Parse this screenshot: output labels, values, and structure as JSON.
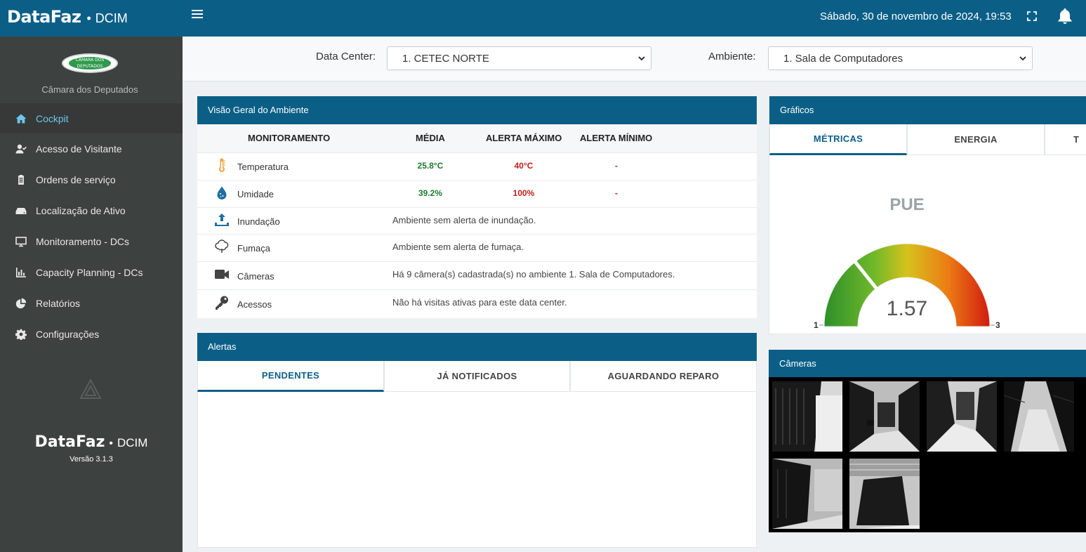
{
  "header": {
    "brand": "DataFaz",
    "brand_sep": "•",
    "brand_suffix": "DCIM",
    "datetime": "Sábado, 30 de novembro de 2024, 19:53",
    "menu_icon": "hamburger-icon",
    "fullscreen_icon": "fullscreen-icon",
    "notify_icon": "bell-icon",
    "color": "#0b5f87"
  },
  "sidebar": {
    "org_logo_text": "CÂMARA DOS DEPUTADOS",
    "org_name": "Câmara dos Deputados",
    "items": [
      {
        "label": "Cockpit",
        "icon": "home-icon",
        "active": true
      },
      {
        "label": "Acesso de Visitante",
        "icon": "user-check-icon"
      },
      {
        "label": "Ordens de serviço",
        "icon": "clipboard-icon"
      },
      {
        "label": "Localização de Ativo",
        "icon": "hard-drive-icon"
      },
      {
        "label": "Monitoramento - DCs",
        "icon": "monitor-icon"
      },
      {
        "label": "Capacity Planning - DCs",
        "icon": "bar-chart-icon"
      },
      {
        "label": "Relatórios",
        "icon": "pie-chart-icon"
      },
      {
        "label": "Configurações",
        "icon": "gear-icon"
      }
    ],
    "footer_brand": "DataFaz",
    "footer_sep": "•",
    "footer_suffix": "DCIM",
    "version": "Versão 3.1.3"
  },
  "filters": {
    "datacenter_label": "Data Center:",
    "datacenter_value": "1. CETEC NORTE",
    "ambiente_label": "Ambiente:",
    "ambiente_value": "1. Sala de Computadores"
  },
  "overview": {
    "title": "Visão Geral do Ambiente",
    "columns": [
      "MONITORAMENTO",
      "MÉDIA",
      "ALERTA MÁXIMO",
      "ALERTA MÍNIMO"
    ],
    "rows": [
      {
        "name": "Temperatura",
        "icon": "thermometer-icon",
        "media": "25.8°C",
        "max": "40°C",
        "min": "-"
      },
      {
        "name": "Umidade",
        "icon": "droplet-icon",
        "media": "39.2%",
        "max": "100%",
        "min": "-"
      },
      {
        "name": "Inundação",
        "icon": "flood-icon",
        "desc": "Ambiente sem alerta de inundação."
      },
      {
        "name": "Fumaça",
        "icon": "smoke-icon",
        "desc": "Ambiente sem alerta de fumaça."
      },
      {
        "name": "Câmeras",
        "icon": "video-camera-icon",
        "desc": "Há 9 câmera(s) cadastrada(s) no ambiente 1. Sala de Computadores."
      },
      {
        "name": "Acessos",
        "icon": "key-icon",
        "desc": "Não há visitas ativas para este data center."
      }
    ],
    "colors": {
      "media": "#1e7a2e",
      "max": "#c0201a",
      "min": "#c0201a"
    }
  },
  "alerts": {
    "title": "Alertas",
    "tabs": [
      "PENDENTES",
      "JÁ NOTIFICADOS",
      "AGUARDANDO REPARO"
    ]
  },
  "charts": {
    "title": "Gráficos",
    "tabs": [
      "MÉTRICAS",
      "ENERGIA",
      "T"
    ],
    "gauge": {
      "label": "PUE",
      "value": 1.57,
      "value_text": "1.57",
      "min_text": "1",
      "max_text": "3",
      "min": 1,
      "max": 3
    }
  },
  "cameras": {
    "title": "Câmeras",
    "feeds": [
      {
        "name": "camera-feed-1"
      },
      {
        "name": "camera-feed-2"
      },
      {
        "name": "camera-feed-3"
      },
      {
        "name": "camera-feed-4"
      },
      {
        "name": "camera-feed-5"
      },
      {
        "name": "camera-feed-6"
      }
    ]
  }
}
